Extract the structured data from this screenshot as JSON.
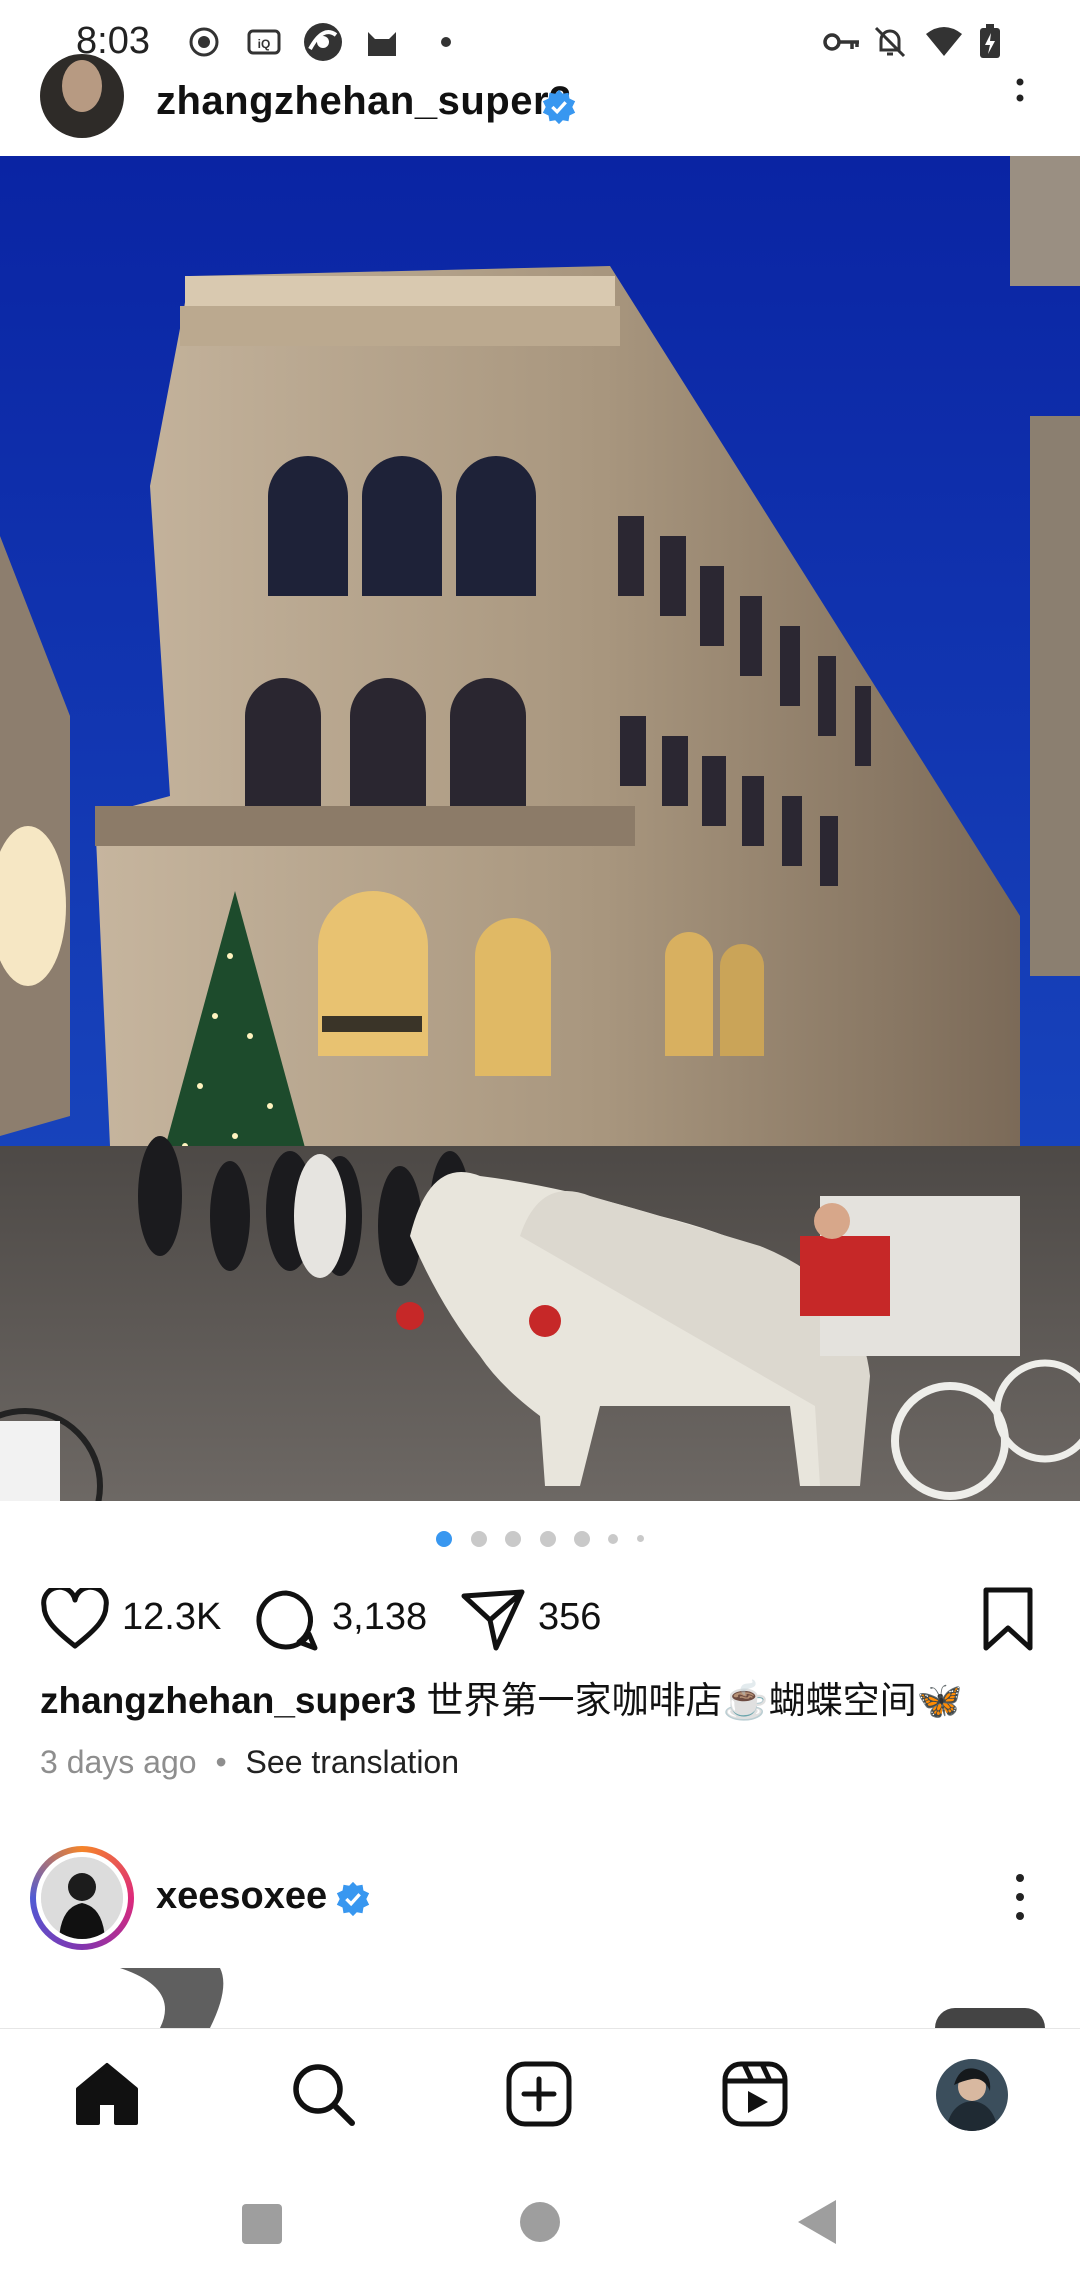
{
  "status_bar": {
    "time": "8:03",
    "left_icons": [
      "record-icon",
      "iqiyi-icon",
      "browser-icon",
      "cat-app-icon",
      "dot-icon"
    ],
    "right_icons": [
      "vpn-key-icon",
      "bell-off-icon",
      "wifi-icon",
      "battery-charging-icon"
    ]
  },
  "post1": {
    "username": "zhangzhehan_super3",
    "verified": true,
    "likes": "12.3K",
    "comments": "3,138",
    "shares": "356",
    "caption_user": "zhangzhehan_super3",
    "caption_text": "世界第一家咖啡店☕️蝴蝶空间🦋",
    "time_ago": "3 days ago",
    "separator": "•",
    "see_translation": "See translation",
    "carousel_count": 7,
    "carousel_active": 0
  },
  "post2": {
    "username": "xeesoxee",
    "verified": true
  },
  "bottom_nav": {
    "items": [
      "home-icon",
      "search-icon",
      "create-icon",
      "reels-icon",
      "profile-avatar"
    ]
  },
  "colors": {
    "accent": "#3897f0",
    "sky": "#0b2aa0",
    "verify": "#3897f0"
  }
}
